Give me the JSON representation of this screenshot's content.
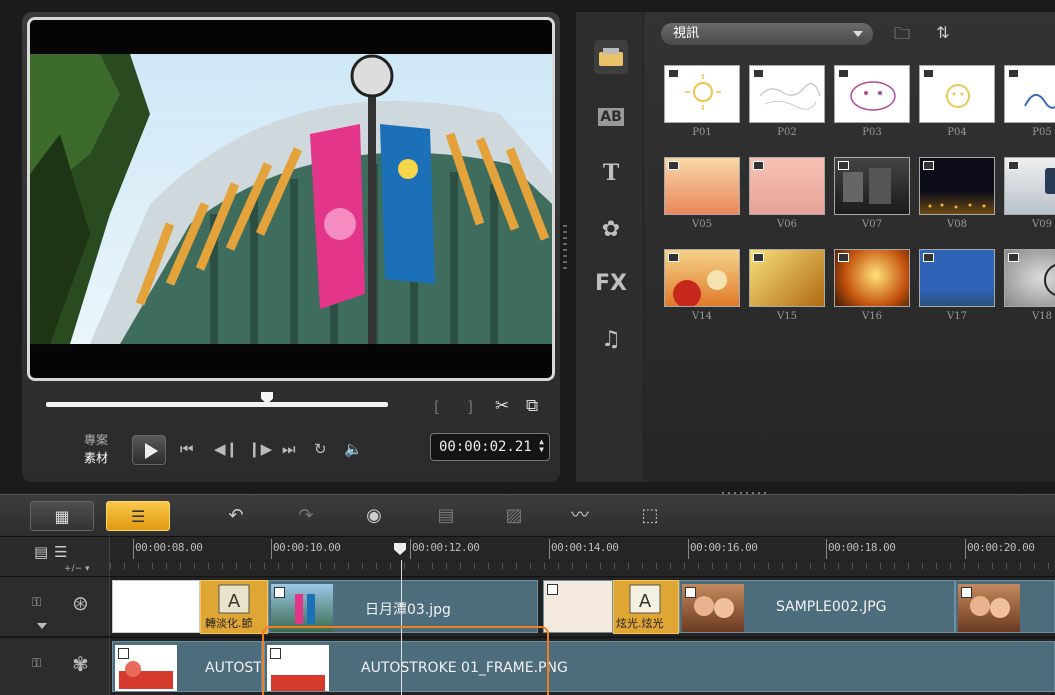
{
  "preview": {
    "project_label": "專案",
    "clip_label": "素材",
    "timecode": "00:00:02.21",
    "mark_in": "[",
    "mark_out": "]"
  },
  "library": {
    "category": "視訊",
    "nav": [
      "media-icon",
      "transition-icon",
      "title-icon",
      "graphic-icon",
      "filter-icon",
      "audio-icon"
    ],
    "nav_text": {
      "ab": "AB",
      "t": "T",
      "fx": "FX"
    },
    "thumbnails": [
      {
        "caption": "P01"
      },
      {
        "caption": "P02"
      },
      {
        "caption": "P03"
      },
      {
        "caption": "P04"
      },
      {
        "caption": "P05"
      },
      {
        "caption": "V05"
      },
      {
        "caption": "V06"
      },
      {
        "caption": "V07"
      },
      {
        "caption": "V08"
      },
      {
        "caption": "V09"
      },
      {
        "caption": "V14"
      },
      {
        "caption": "V15"
      },
      {
        "caption": "V16"
      },
      {
        "caption": "V17"
      },
      {
        "caption": "V18"
      }
    ]
  },
  "timeline": {
    "zoom_label": "+/− ▾",
    "ticks": [
      "00:00:08.00",
      "00:00:10.00",
      "00:00:12.00",
      "00:00:14.00",
      "00:00:16.00",
      "00:00:18.00",
      "00:00:20.00"
    ],
    "video_track": {
      "transition_1": "轉淡化.節",
      "clip_1_title": "日月潭03.jpg",
      "transition_2": "炫光.炫光",
      "clip_2_title": "SAMPLE002.JPG"
    },
    "overlay_track": {
      "clip_1_title": "AUTOST",
      "clip_2_title": "AUTOSTROKE 01_FRAME.PNG"
    }
  },
  "colors": {
    "accent": "#f5b52a",
    "selection": "#ef7d22",
    "clip": "#4d6c7c"
  }
}
